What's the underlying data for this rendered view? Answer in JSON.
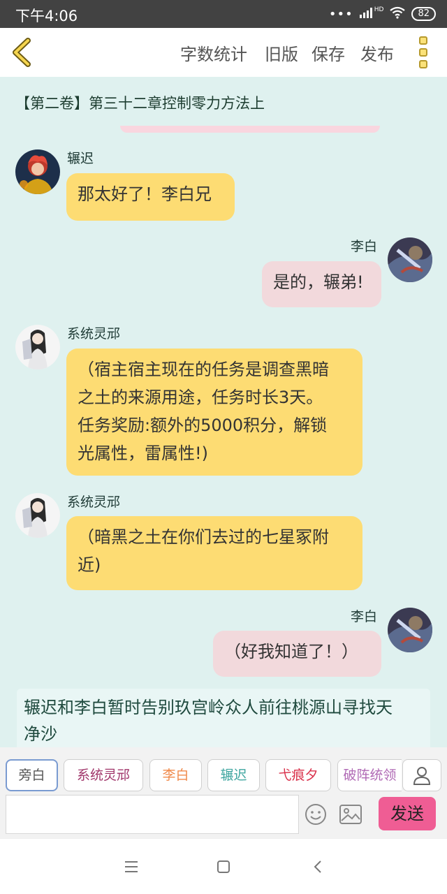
{
  "status": {
    "time": "下午4:06",
    "signal": "HD",
    "battery": "82"
  },
  "header": {
    "menu": [
      "字数统计",
      "旧版",
      "保存",
      "发布"
    ]
  },
  "chapter_title": "【第二卷】第三十二章控制零力方法上",
  "messages": [
    {
      "side": "left",
      "name": "辗迟",
      "text": "那太好了！李白兄"
    },
    {
      "side": "right",
      "name": "李白",
      "text": "是的，辗弟!"
    },
    {
      "side": "left",
      "name": "系统灵邧",
      "lines": [
        "（宿主宿主现在的任务是调查黑暗",
        "之土的来源用途，任务时长3天。",
        "任务奖励:额外的5000积分，解锁",
        "光属性，雷属性!)"
      ]
    },
    {
      "side": "left",
      "name": "系统灵邧",
      "lines": [
        "（暗黑之土在你们去过的七星冢附",
        "近)"
      ]
    },
    {
      "side": "right",
      "name": "李白",
      "text": "（好我知道了！）"
    }
  ],
  "narration": [
    "辗迟和李白暂时告别玖宫岭众人前往桃源山寻找天",
    "净沙"
  ],
  "roles": [
    {
      "label": "旁白",
      "color": "#555555"
    },
    {
      "label": "系统灵邧",
      "color": "#a0356a"
    },
    {
      "label": "李白",
      "color": "#f08a4b"
    },
    {
      "label": "辗迟",
      "color": "#3fa6a0"
    },
    {
      "label": "弋痕夕",
      "color": "#d9304a"
    },
    {
      "label": "破阵统领",
      "color": "#b06ab5"
    }
  ],
  "input": {
    "value": "",
    "placeholder": ""
  },
  "send_label": "发送",
  "icons": {
    "back": "chevron-left-icon",
    "more": "more-vertical-icon",
    "user": "user-icon",
    "emoji": "emoji-icon",
    "image": "image-icon",
    "nav": [
      "menu-icon",
      "home-icon",
      "back-icon"
    ]
  }
}
